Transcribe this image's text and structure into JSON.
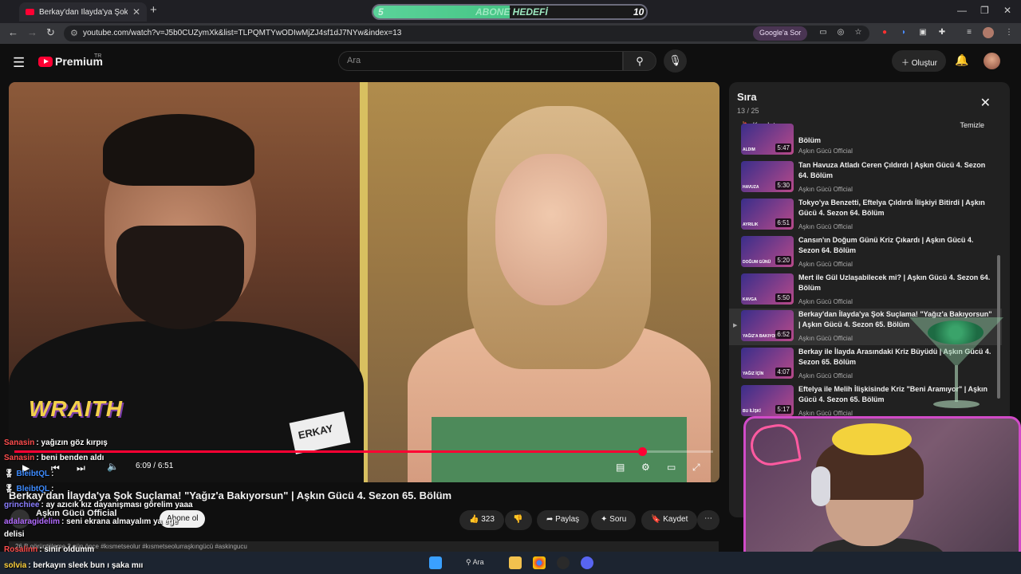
{
  "browser": {
    "tab_title": "Berkay'dan İlayda'ya Şok Suçlama! \"Yağız'a Bakıyorsun\" | Aşkın Gücü 4. Sezon 65. Bölüm",
    "url": "youtube.com/watch?v=J5b0CUZymXk&list=TLPQMTYwODIwMjZJ4sf1dJ7NYw&index=13",
    "google_sor": "Google'a Sor"
  },
  "abone_hedefi": {
    "label": "ABONE HEDEFİ",
    "current": "5",
    "goal": "10",
    "progress_fraction": 0.5,
    "fill_color": "#4fcb8f"
  },
  "youtube": {
    "logo_text": "Premium",
    "country_code": "TR",
    "search_placeholder": "Ara",
    "create_label": "Oluştur"
  },
  "video": {
    "overlay_brand": "WRAITH",
    "nametag": "ERKAY",
    "current_time": "6:09",
    "duration": "6:51",
    "progress_fraction": 0.898,
    "accent": "#ff0033"
  },
  "stream_chat": [
    {
      "user": "Sanasin",
      "message": ": yağızın göz kırpış",
      "color": "#ff4d4d"
    },
    {
      "user": "Sanasin",
      "message": ": beni benden aldı",
      "color": "#ff4d4d"
    },
    {
      "user": "BleibtQL",
      "message": ":",
      "color": "#3d8bff"
    },
    {
      "user": "BleibtQL",
      "message": ":",
      "color": "#3d8bff"
    },
    {
      "user": "grinchiee",
      "message": ": ay azıcık kız dayanışması görelim yaaa",
      "color": "#8a7dff"
    },
    {
      "user": "adalaragidelim",
      "message": ": seni ekrana almayalım ya ege",
      "color": "#b26bff"
    },
    {
      "user": "",
      "message": "delisi",
      "color": "#ffffff"
    },
    {
      "user": "Rosalinn",
      "message": ": sinir oldumm",
      "color": "#ff4d4d"
    },
    {
      "user": "solvia",
      "message": ": berkayın sleek bun ı şaka mıı",
      "color": "#ffd23d"
    }
  ],
  "watch": {
    "title": "Berkay'dan İlayda'ya Şok Suçlama! \"Yağız'a Bakıyorsun\" | Aşkın Gücü 4. Sezon 65. Bölüm",
    "channel": "Aşkın Gücü Official",
    "subscribe": "Abone ol",
    "likes": "323",
    "share": "Paylaş",
    "ask": "Soru",
    "save": "Kaydet",
    "description_line": "26 B görüntüleme 2 gün önce #kısmetseolur #kısmetseolurraşkıngücü #askingucu"
  },
  "queue": {
    "title": "Sıra",
    "position": "13 / 25",
    "save_label": "Kaydet",
    "clear_label": "Temizle",
    "items": [
      {
        "title": "Bölüm",
        "channel": "Aşkın Gücü Official",
        "duration": "5:47",
        "thumb_tag": "ALDIM"
      },
      {
        "title": "Tan Havuza Atladı Ceren Çıldırdı | Aşkın Gücü 4. Sezon 64. Bölüm",
        "channel": "Aşkın Gücü Official",
        "duration": "5:30",
        "thumb_tag": "HAVUZA"
      },
      {
        "title": "Tokyo'ya Benzetti, Eftelya Çıldırdı İlişkiyi Bitirdi | Aşkın Gücü 4. Sezon 64. Bölüm",
        "channel": "Aşkın Gücü Official",
        "duration": "6:51",
        "thumb_tag": "AYRILIK"
      },
      {
        "title": "Cansın'ın Doğum Günü Kriz Çıkardı | Aşkın Gücü 4. Sezon 64. Bölüm",
        "channel": "Aşkın Gücü Official",
        "duration": "5:20",
        "thumb_tag": "DOĞUM GÜNÜ"
      },
      {
        "title": "Mert ile Gül Uzlaşabilecek mi? | Aşkın Gücü 4. Sezon 64. Bölüm",
        "channel": "Aşkın Gücü Official",
        "duration": "5:50",
        "thumb_tag": "KAVGA"
      },
      {
        "title": "Berkay'dan İlayda'ya Şok Suçlama! \"Yağız'a Bakıyorsun\" | Aşkın Gücü 4. Sezon 65. Bölüm",
        "channel": "Aşkın Gücü Official",
        "duration": "6:52",
        "thumb_tag": "YAĞIZ'A BAKIYOR!",
        "active": true
      },
      {
        "title": "Berkay ile İlayda Arasındaki Kriz Büyüdü | Aşkın Gücü 4. Sezon 65. Bölüm",
        "channel": "Aşkın Gücü Official",
        "duration": "4:07",
        "thumb_tag": "YAĞIZ İÇİN"
      },
      {
        "title": "Eftelya ile Melih İlişkisinde Kriz \"Beni Aramıyor\" | Aşkın Gücü 4. Sezon 65. Bölüm",
        "channel": "Aşkın Gücü Official",
        "duration": "5:17",
        "thumb_tag": "BU İLİŞKİ"
      }
    ]
  },
  "taskbar": {
    "search_label": "Ara"
  }
}
